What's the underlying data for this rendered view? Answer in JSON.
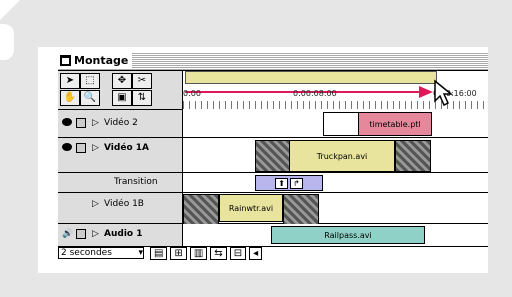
{
  "window": {
    "title": "Montage"
  },
  "ruler": {
    "time_left": "0:00",
    "time_mid": "0:00:08:00",
    "time_right": "0:00:16:00"
  },
  "tracks": [
    {
      "name": "Vidéo 2",
      "clip": "timetable.ptl"
    },
    {
      "name": "Vidéo 1A",
      "clip": "Truckpan.avi"
    },
    {
      "name": "Transition"
    },
    {
      "name": "Vidéo 1B",
      "clip": "Rainwtr.avi"
    },
    {
      "name": "Audio 1",
      "clip": "Railpass.avi"
    }
  ],
  "bottom": {
    "time_unit": "2 secondes"
  }
}
